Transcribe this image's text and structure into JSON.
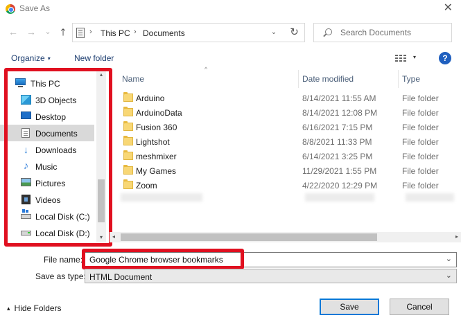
{
  "window": {
    "title": "Save As",
    "close_glyph": "✕",
    "app_icon": "chrome-icon"
  },
  "nav": {
    "back_glyph": "←",
    "forward_glyph": "→",
    "recent_glyph": "⌄",
    "up_glyph": "🡑",
    "breadcrumbs": [
      "This PC",
      "Documents"
    ],
    "crumb_sep": "›",
    "refresh_glyph": "↻",
    "dropdown_glyph": "⌄",
    "search_placeholder": "Search Documents"
  },
  "toolbar": {
    "organize_label": "Organize",
    "caret": "▾",
    "new_folder_label": "New folder",
    "help_label": "?"
  },
  "sidebar": {
    "items": [
      {
        "label": "This PC",
        "icon": "computer-icon"
      },
      {
        "label": "3D Objects",
        "icon": "3d-objects-icon"
      },
      {
        "label": "Desktop",
        "icon": "desktop-icon"
      },
      {
        "label": "Documents",
        "icon": "documents-icon",
        "selected": true
      },
      {
        "label": "Downloads",
        "icon": "downloads-icon"
      },
      {
        "label": "Music",
        "icon": "music-icon"
      },
      {
        "label": "Pictures",
        "icon": "pictures-icon"
      },
      {
        "label": "Videos",
        "icon": "videos-icon"
      },
      {
        "label": "Local Disk (C:)",
        "icon": "local-disk-c-icon"
      },
      {
        "label": "Local Disk (D:)",
        "icon": "local-disk-d-icon"
      }
    ],
    "scroll_up": "▴",
    "scroll_down": "▾"
  },
  "file_list": {
    "columns": [
      "Name",
      "Date modified",
      "Type"
    ],
    "sort_glyph": "^",
    "rows": [
      {
        "name": "Arduino",
        "date": "8/14/2021 11:55 AM",
        "type": "File folder"
      },
      {
        "name": "ArduinoData",
        "date": "8/14/2021 12:08 PM",
        "type": "File folder"
      },
      {
        "name": "Fusion 360",
        "date": "6/16/2021 7:15 PM",
        "type": "File folder"
      },
      {
        "name": "Lightshot",
        "date": "8/8/2021 11:33 PM",
        "type": "File folder"
      },
      {
        "name": "meshmixer",
        "date": "6/14/2021 3:25 PM",
        "type": "File folder"
      },
      {
        "name": "My Games",
        "date": "11/29/2021 1:55 PM",
        "type": "File folder"
      },
      {
        "name": "Zoom",
        "date": "4/22/2020 12:29 PM",
        "type": "File folder"
      }
    ],
    "scroll_left": "◂",
    "scroll_right": "▸"
  },
  "form": {
    "file_name_label": "File name:",
    "file_name_value": "Google Chrome browser bookmarks",
    "save_type_label": "Save as type:",
    "save_type_value": "HTML Document",
    "dropdown_glyph": "⌄"
  },
  "footer": {
    "hide_folders_label": "Hide Folders",
    "hide_caret": "▴",
    "save_label": "Save",
    "cancel_label": "Cancel"
  },
  "colors": {
    "highlight": "#e01020",
    "selected_row": "#d9d9d9",
    "link": "#1b3c6f",
    "help_blue": "#1f5fbf"
  }
}
